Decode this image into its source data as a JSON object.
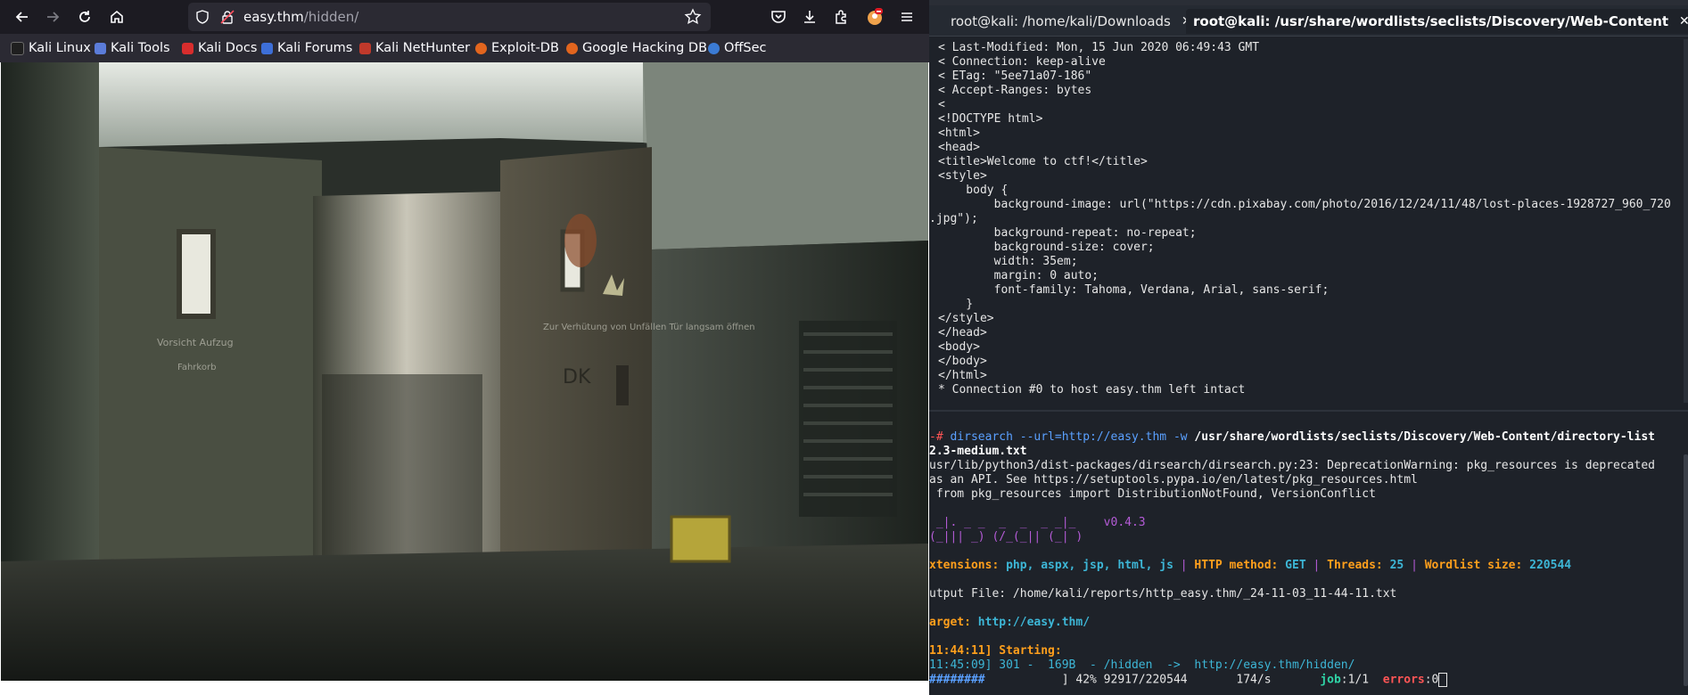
{
  "browser": {
    "url_host": "easy.thm",
    "url_path": "/hidden/",
    "bookmarks": [
      "Kali Linux",
      "Kali Tools",
      "Kali Docs",
      "Kali Forums",
      "Kali NetHunter",
      "Exploit-DB",
      "Google Hacking DB",
      "OffSec"
    ],
    "page_image_text": [
      "Vorsicht Aufzug",
      "Fahrkorb",
      "Zur Verhütung von Unfällen Tür langsam öffnen",
      "DK"
    ]
  },
  "terminal": {
    "tabs": [
      "root@kali: /home/kali/Downloads",
      "root@kali: /usr/share/wordlists/seclists/Discovery/Web-Content"
    ],
    "top_lines": [
      "< Last-Modified: Mon, 15 Jun 2020 06:49:43 GMT",
      "< Connection: keep-alive",
      "< ETag: \"5ee71a07-186\"",
      "< Accept-Ranges: bytes",
      "<",
      "<!DOCTYPE html>",
      "<html>",
      "<head>",
      "<title>Welcome to ctf!</title>",
      "<style>",
      "    body {",
      "        background-image: url(\"https://cdn.pixabay.com/photo/2016/12/24/11/48/lost-places-1928727_960_720",
      ".jpg\");",
      "        background-repeat: no-repeat;",
      "        background-size: cover;",
      "        width: 35em;",
      "        margin: 0 auto;",
      "        font-family: Tahoma, Verdana, Arial, sans-serif;",
      "    }",
      "</style>",
      "</head>",
      "<body>",
      "</body>",
      "</html>",
      "* Connection #0 to host easy.thm left intact"
    ],
    "cmd_prompt": "-# ",
    "cmd_text": "dirsearch --url=http://easy.thm -w ",
    "cmd_path": "/usr/share/wordlists/seclists/Discovery/Web-Content/directory-list",
    "cmd_path2": "2.3-medium.txt",
    "warn_lines": [
      "usr/lib/python3/dist-packages/dirsearch/dirsearch.py:23: DeprecationWarning: pkg_resources is deprecated",
      "as an API. See https://setuptools.pypa.io/en/latest/pkg_resources.html",
      " from pkg_resources import DistributionNotFound, VersionConflict"
    ],
    "banner_line1": " _|. _ _  _  _  _ _|_    ",
    "banner_line2": "(_||| _) (/_(_|| (_| )   ",
    "version": "v0.4.3",
    "ext_label": "xtensions: ",
    "ext_value": "php, aspx, jsp, html, js",
    "sep": " | ",
    "method_label": "HTTP method: ",
    "method_value": "GET",
    "threads_label": "Threads: ",
    "threads_value": "25",
    "wordlist_label": "Wordlist size: ",
    "wordlist_value": "220544",
    "output_line": "utput File: /home/kali/reports/http_easy.thm/_24-11-03_11-44-11.txt",
    "target_label": "arget: ",
    "target_value": "http://easy.thm/",
    "starting": "11:44:11] Starting:",
    "found_line": "11:45:09] 301 -  169B  - /hidden  ->  http://easy.thm/hidden/",
    "progress_bar": "########",
    "progress_text": "           ] 42% 92917/220544       174/s       ",
    "job_label": "job",
    "job_value": ":1/1  ",
    "errors_label": "errors",
    "errors_value": ":0",
    "progress_percent": 42
  }
}
